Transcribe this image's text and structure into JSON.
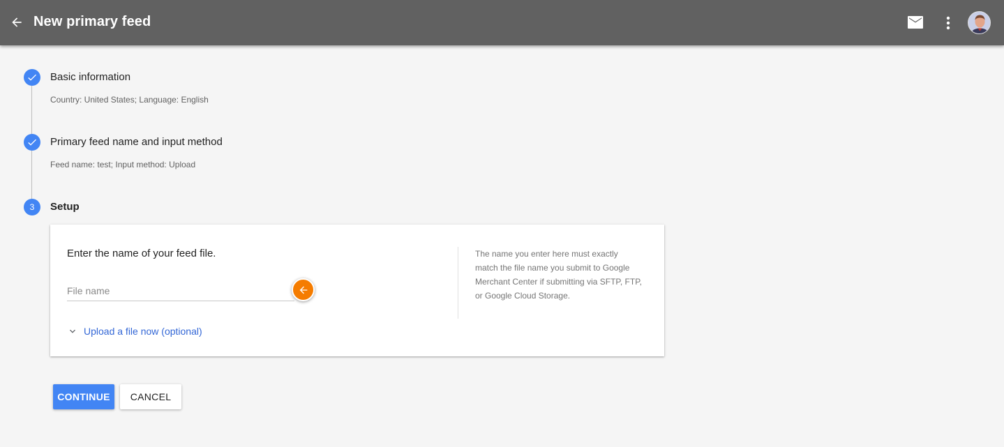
{
  "header": {
    "title": "New primary feed",
    "back_icon": "arrow-left-icon",
    "mail_icon": "mail-icon",
    "more_icon": "more-vertical-icon",
    "avatar_icon": "user-avatar"
  },
  "steps": [
    {
      "number": "1",
      "status": "complete",
      "title": "Basic information",
      "summary": "Country: United States; Language: English"
    },
    {
      "number": "2",
      "status": "complete",
      "title": "Primary feed name and input method",
      "summary": "Feed name: test; Input method: Upload"
    },
    {
      "number": "3",
      "status": "active",
      "title": "Setup"
    }
  ],
  "setup_card": {
    "prompt": "Enter the name of your feed file.",
    "file_input": {
      "value": "",
      "placeholder": "File name"
    },
    "upload_link": "Upload a file now (optional)",
    "help_text": "The name you enter here must exactly match the file name you submit to Google Merchant Center if submitting via SFTP, FTP, or Google Cloud Storage."
  },
  "actions": {
    "continue_label": "CONTINUE",
    "cancel_label": "CANCEL"
  },
  "colors": {
    "appbar": "#616161",
    "accent": "#4285f4",
    "link": "#3367d6",
    "hint_pin": "#f57c00",
    "background": "#f5f5f5"
  }
}
